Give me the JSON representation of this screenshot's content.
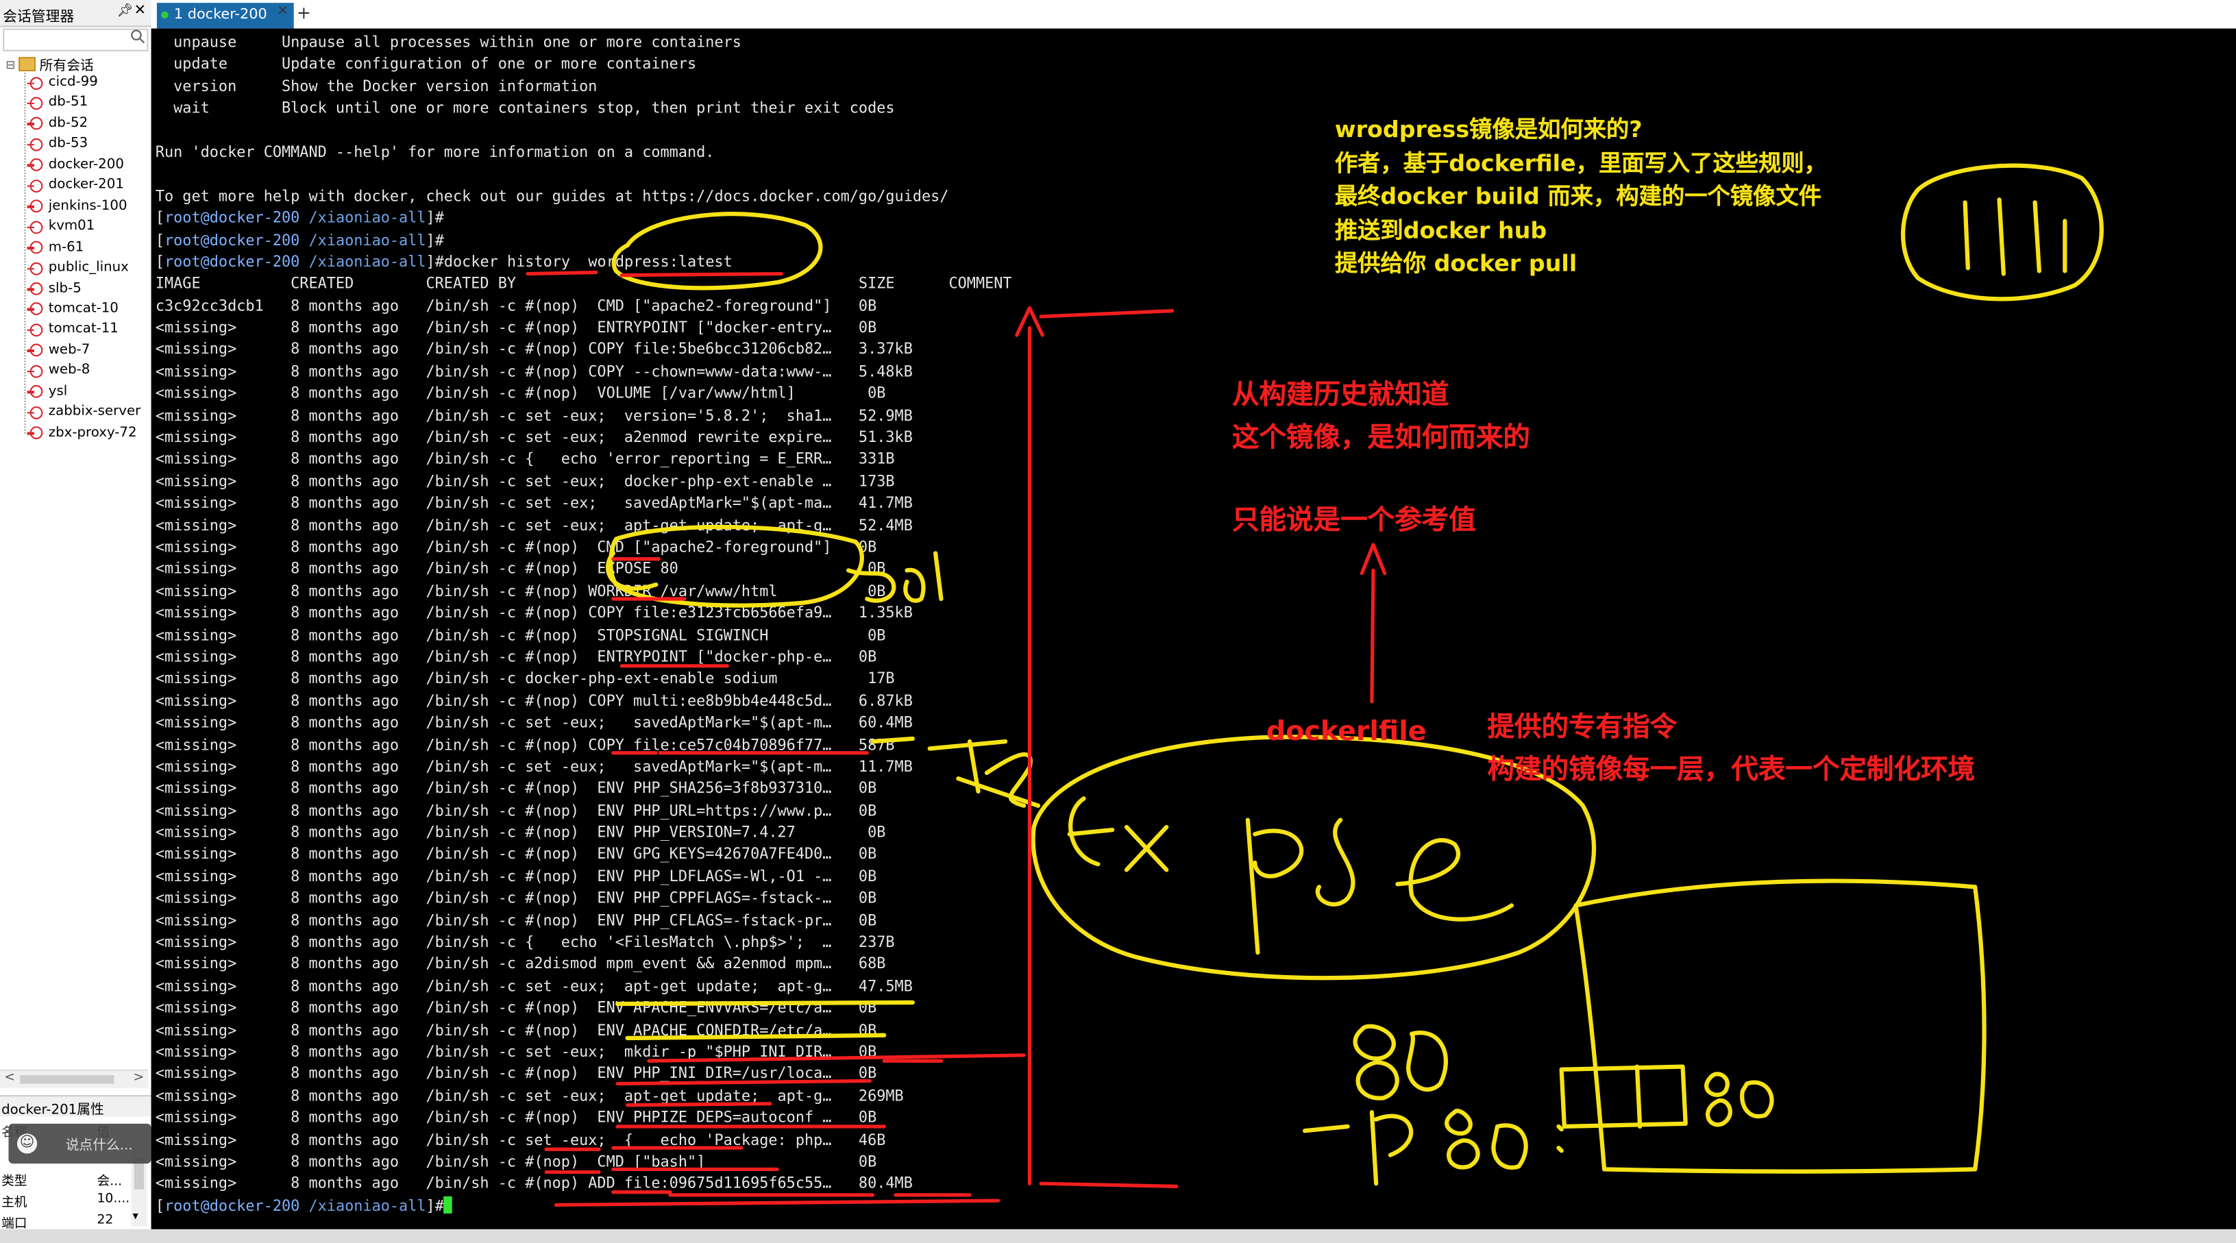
{
  "session_manager": {
    "title": "会话管理器",
    "pin_icon": "pin-icon",
    "close_icon": "close-icon",
    "root_folder": "所有会话",
    "sessions": [
      "cicd-99",
      "db-51",
      "db-52",
      "db-53",
      "docker-200",
      "docker-201",
      "jenkins-100",
      "kvm01",
      "m-61",
      "public_linux",
      "slb-5",
      "tomcat-10",
      "tomcat-11",
      "web-7",
      "web-8",
      "ysl",
      "zabbix-server",
      "zbx-proxy-72"
    ],
    "scroll_left": "<",
    "scroll_right": ">"
  },
  "properties": {
    "title": "docker-201属性",
    "header": {
      "name": "名称",
      "value": "值"
    },
    "rows": [
      {
        "key": "类型",
        "value": "会..."
      },
      {
        "key": "主机",
        "value": "10...."
      },
      {
        "key": "端口",
        "value": "22"
      }
    ]
  },
  "chat_overlay": {
    "placeholder": "说点什么..."
  },
  "tab": {
    "label": "1 docker-200",
    "close": "×",
    "add": "+"
  },
  "terminal": {
    "help_lines": [
      "  unpause     Unpause all processes within one or more containers",
      "  update      Update configuration of one or more containers",
      "  version     Show the Docker version information",
      "  wait        Block until one or more containers stop, then print their exit codes",
      "",
      "Run 'docker COMMAND --help' for more information on a command.",
      "",
      "To get more help with docker, check out our guides at https://docs.docker.com/go/guides/"
    ],
    "prompt": {
      "user_host": "root@docker-200",
      "cwd": "/xiaoniao-all",
      "suffix": "#"
    },
    "command": "docker history  wordpress:latest",
    "history_header": "IMAGE          CREATED        CREATED BY                                      SIZE      COMMENT",
    "history_rows": [
      "c3c92cc3dcb1   8 months ago   /bin/sh -c #(nop)  CMD [\"apache2-foreground\"]   0B",
      "<missing>      8 months ago   /bin/sh -c #(nop)  ENTRYPOINT [\"docker-entry…   0B",
      "<missing>      8 months ago   /bin/sh -c #(nop) COPY file:5be6bcc31206cb82…   3.37kB",
      "<missing>      8 months ago   /bin/sh -c #(nop) COPY --chown=www-data:www-…   5.48kB",
      "<missing>      8 months ago   /bin/sh -c #(nop)  VOLUME [/var/www/html]        0B",
      "<missing>      8 months ago   /bin/sh -c set -eux;  version='5.8.2';  sha1…   52.9MB",
      "<missing>      8 months ago   /bin/sh -c set -eux;  a2enmod rewrite expire…   51.3kB",
      "<missing>      8 months ago   /bin/sh -c {   echo 'error_reporting = E_ERR…   331B",
      "<missing>      8 months ago   /bin/sh -c set -eux;  docker-php-ext-enable …   173B",
      "<missing>      8 months ago   /bin/sh -c set -ex;   savedAptMark=\"$(apt-ma…   41.7MB",
      "<missing>      8 months ago   /bin/sh -c set -eux;  apt-get update;  apt-g…   52.4MB",
      "<missing>      8 months ago   /bin/sh -c #(nop)  CMD [\"apache2-foreground\"]   0B",
      "<missing>      8 months ago   /bin/sh -c #(nop)  EXPOSE 80                     0B",
      "<missing>      8 months ago   /bin/sh -c #(nop) WORKDIR /var/www/html          0B",
      "<missing>      8 months ago   /bin/sh -c #(nop) COPY file:e3123fcb6566efa9…   1.35kB",
      "<missing>      8 months ago   /bin/sh -c #(nop)  STOPSIGNAL SIGWINCH           0B",
      "<missing>      8 months ago   /bin/sh -c #(nop)  ENTRYPOINT [\"docker-php-e…   0B",
      "<missing>      8 months ago   /bin/sh -c docker-php-ext-enable sodium          17B",
      "<missing>      8 months ago   /bin/sh -c #(nop) COPY multi:ee8b9bb4e448c5d…   6.87kB",
      "<missing>      8 months ago   /bin/sh -c set -eux;   savedAptMark=\"$(apt-m…   60.4MB",
      "<missing>      8 months ago   /bin/sh -c #(nop) COPY file:ce57c04b70896f77…   587B",
      "<missing>      8 months ago   /bin/sh -c set -eux;   savedAptMark=\"$(apt-m…   11.7MB",
      "<missing>      8 months ago   /bin/sh -c #(nop)  ENV PHP_SHA256=3f8b937310…   0B",
      "<missing>      8 months ago   /bin/sh -c #(nop)  ENV PHP_URL=https://www.p…   0B",
      "<missing>      8 months ago   /bin/sh -c #(nop)  ENV PHP_VERSION=7.4.27        0B",
      "<missing>      8 months ago   /bin/sh -c #(nop)  ENV GPG_KEYS=42670A7FE4D0…   0B",
      "<missing>      8 months ago   /bin/sh -c #(nop)  ENV PHP_LDFLAGS=-Wl,-O1 -…   0B",
      "<missing>      8 months ago   /bin/sh -c #(nop)  ENV PHP_CPPFLAGS=-fstack-…   0B",
      "<missing>      8 months ago   /bin/sh -c #(nop)  ENV PHP_CFLAGS=-fstack-pr…   0B",
      "<missing>      8 months ago   /bin/sh -c {   echo '<FilesMatch \\.php$>';  …   237B",
      "<missing>      8 months ago   /bin/sh -c a2dismod mpm_event && a2enmod mpm…   68B",
      "<missing>      8 months ago   /bin/sh -c set -eux;  apt-get update;  apt-g…   47.5MB",
      "<missing>      8 months ago   /bin/sh -c #(nop)  ENV APACHE_ENVVARS=/etc/a…   0B",
      "<missing>      8 months ago   /bin/sh -c #(nop)  ENV APACHE_CONFDIR=/etc/a…   0B",
      "<missing>      8 months ago   /bin/sh -c set -eux;  mkdir -p \"$PHP_INI_DIR…   0B",
      "<missing>      8 months ago   /bin/sh -c #(nop)  ENV PHP_INI_DIR=/usr/loca…   0B",
      "<missing>      8 months ago   /bin/sh -c set -eux;  apt-get update;  apt-g…   269MB",
      "<missing>      8 months ago   /bin/sh -c #(nop)  ENV PHPIZE_DEPS=autoconf …   0B",
      "<missing>      8 months ago   /bin/sh -c set -eux;  {   echo 'Package: php…   46B",
      "<missing>      8 months ago   /bin/sh -c #(nop)  CMD [\"bash\"]                 0B",
      "<missing>      8 months ago   /bin/sh -c #(nop) ADD file:09675d11695f65c55…   80.4MB"
    ]
  },
  "annotations": {
    "yellow_note": [
      "wrodpress镜像是如何来的?",
      "作者，基于dockerfile，里面写入了这些规则，",
      "最终docker build 而来，构建的一个镜像文件",
      "推送到docker hub",
      "提供给你 docker  pull"
    ],
    "red_note_1": [
      "从构建历史就知道",
      "这个镜像，是如何而来的"
    ],
    "red_note_2": "只能说是一个参考值",
    "dockerfile_label": "dockerlfile",
    "red_note_3": [
      "提供的专有指令",
      "构建的镜像每一层，代表一个定制化环境"
    ],
    "colors": {
      "yellow": "#f6e216",
      "red": "#f21e1e"
    }
  },
  "colors": {
    "terminal_bg": "#000000",
    "terminal_fg": "#e6e6e6",
    "prompt_blue": "#7fb2ff",
    "cursor": "#31e631",
    "tab_active": "#1b6aa8"
  }
}
